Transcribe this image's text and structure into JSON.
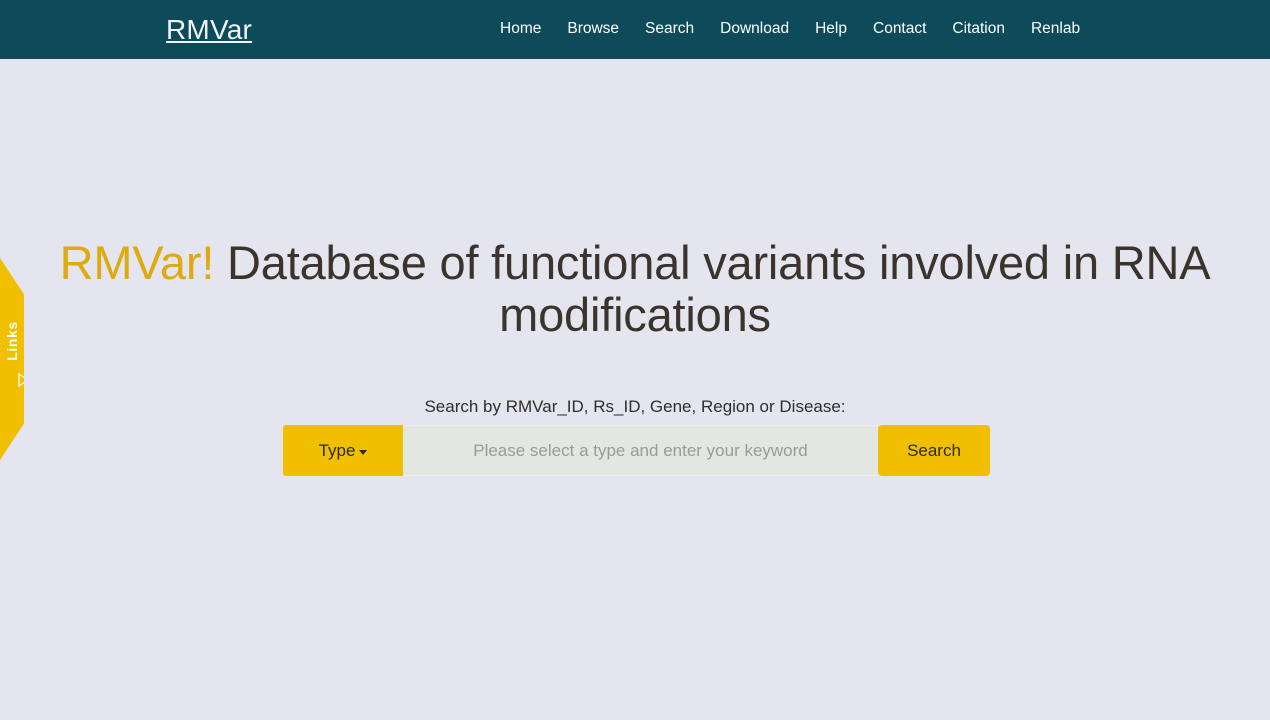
{
  "navbar": {
    "brand": "RMVar",
    "links": [
      {
        "label": "Home"
      },
      {
        "label": "Browse"
      },
      {
        "label": "Search"
      },
      {
        "label": "Download"
      },
      {
        "label": "Help"
      },
      {
        "label": "Contact"
      },
      {
        "label": "Citation"
      },
      {
        "label": "Renlab"
      }
    ],
    "background_color": "#0e4b5a",
    "text_color": "#ffffff"
  },
  "side_tab": {
    "label": "Links",
    "arrow_icon": "triangle-right-icon",
    "color": "#f0c000"
  },
  "hero": {
    "title_accent": "RMVar!",
    "title_rest": " Database of functional variants involved in RNA modifications",
    "accent_color": "#ddaa0f",
    "text_color": "#3b342c"
  },
  "search": {
    "caption": "Search by RMVar_ID, Rs_ID, Gene, Region or Disease:",
    "type_button_label": "Type",
    "type_button_icon": "chevron-down-icon",
    "input_value": "",
    "placeholder": "Please select a type and enter your keyword",
    "submit_label": "Search",
    "button_color": "#f0c000",
    "input_background": "#e3e7e2"
  },
  "page": {
    "background_color": "#e5e5ef"
  }
}
